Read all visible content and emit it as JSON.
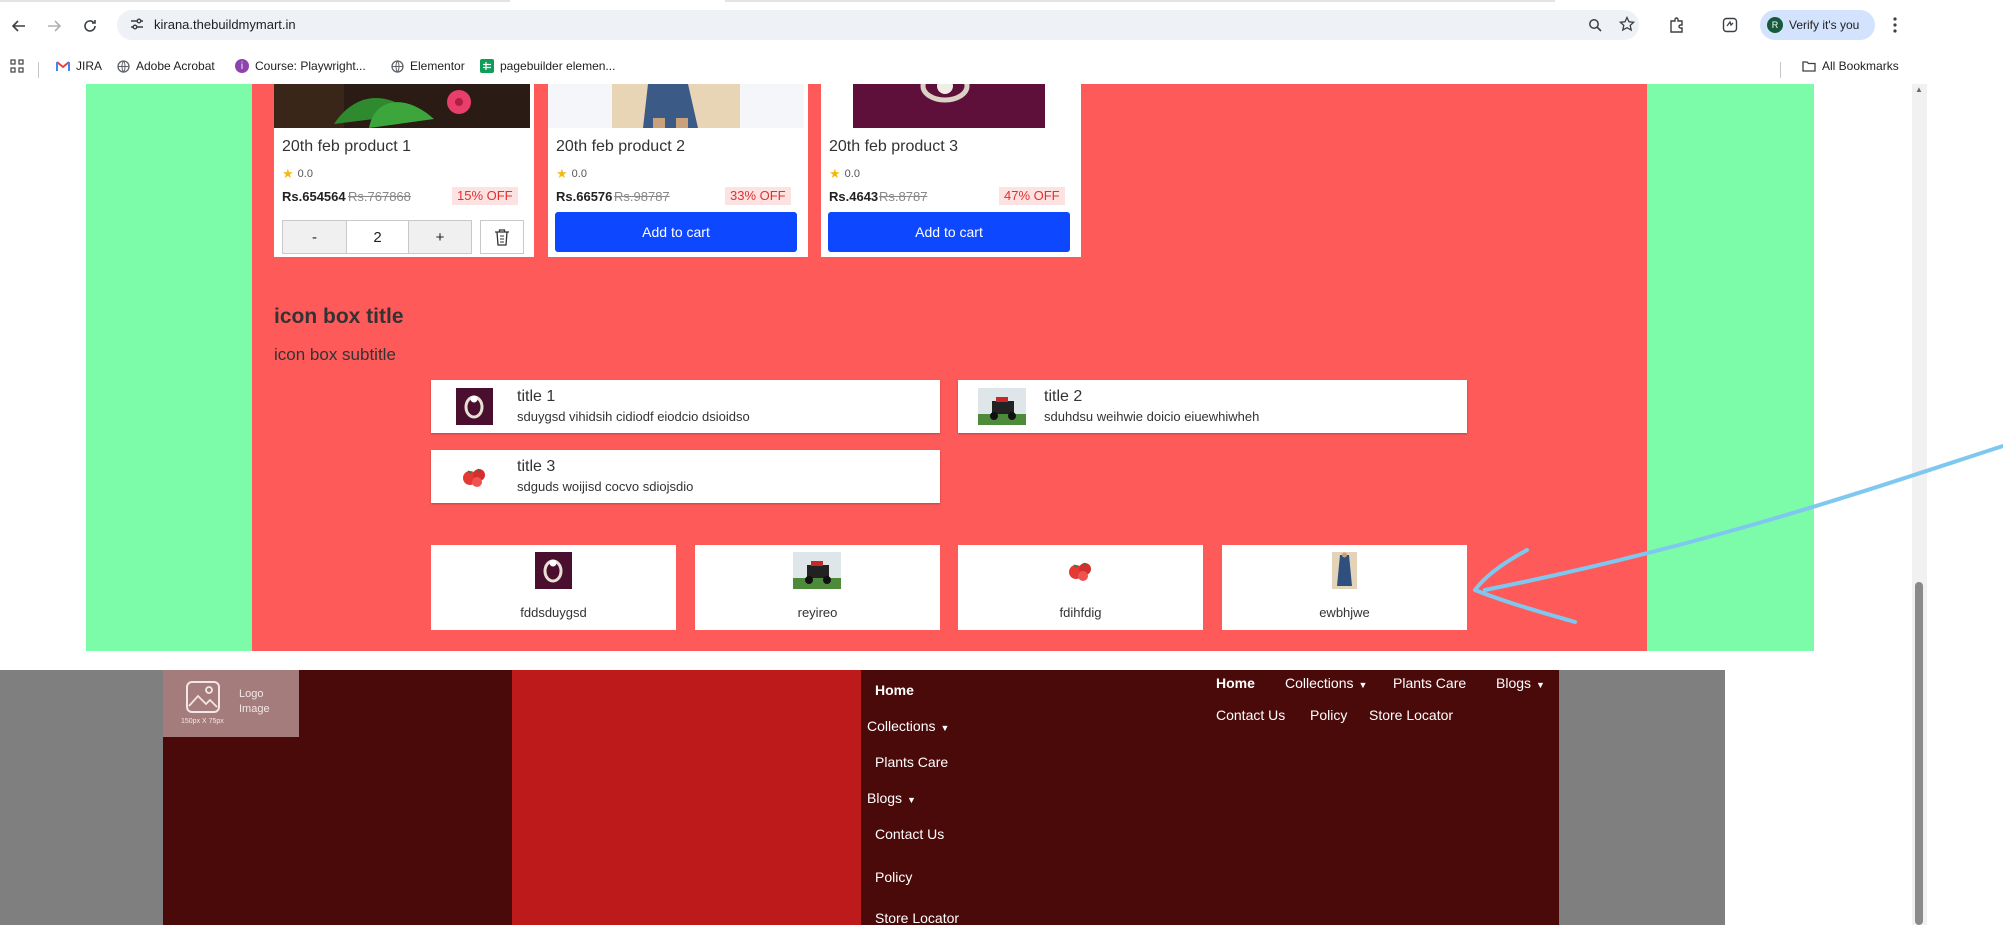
{
  "browser": {
    "url": "kirana.thebuildmymart.in",
    "verify_label": "Verify it's you",
    "avatar_initial": "R",
    "bookmarks": [
      {
        "label": "JIRA",
        "icon": "gmail-icon",
        "color": "#ea4335"
      },
      {
        "label": "Adobe Acrobat",
        "icon": "globe-icon",
        "color": "#5f6368"
      },
      {
        "label": "Course: Playwright...",
        "icon": "course-icon",
        "color": "#8e44ad"
      },
      {
        "label": "Elementor",
        "icon": "globe-icon",
        "color": "#5f6368"
      },
      {
        "label": "pagebuilder elemen...",
        "icon": "sheets-icon",
        "color": "#0f9d58"
      }
    ],
    "all_bookmarks": "All Bookmarks"
  },
  "products": [
    {
      "name": "20th feb product 1",
      "rating": "0.0",
      "price": "Rs.654564",
      "mrp": "Rs.767868",
      "discount": "15% OFF",
      "quantity": "2",
      "in_cart": true
    },
    {
      "name": "20th feb product 2",
      "rating": "0.0",
      "price": "Rs.66576",
      "mrp": "Rs.98787",
      "discount": "33% OFF",
      "button": "Add to cart",
      "in_cart": false
    },
    {
      "name": "20th feb product 3",
      "rating": "0.0",
      "price": "Rs.4643",
      "mrp": "Rs.8787",
      "discount": "47% OFF",
      "button": "Add to cart",
      "in_cart": false
    }
  ],
  "cart_controls": {
    "minus": "-",
    "plus": "+"
  },
  "icon_box": {
    "title": "icon box title",
    "subtitle": "icon box subtitle",
    "items": [
      {
        "title": "title 1",
        "text": "sduygsd vihidsih cidiodf eiodcio dsioidso",
        "image": "ring-thumbnail"
      },
      {
        "title": "title 2",
        "text": "sduhdsu weihwie doicio eiuewhiwheh",
        "image": "lawnmower-thumbnail"
      },
      {
        "title": "title 3",
        "text": "sdguds woijisd cocvo sdiojsdio",
        "image": "tomato-thumbnail"
      }
    ]
  },
  "categories": [
    {
      "label": "fddsduygsd",
      "image": "ring-thumbnail"
    },
    {
      "label": "reyireo",
      "image": "lawnmower-thumbnail"
    },
    {
      "label": "fdihfdig",
      "image": "tomato-thumbnail"
    },
    {
      "label": "ewbhjwe",
      "image": "dress-thumbnail"
    }
  ],
  "footer": {
    "logo": {
      "label_line1": "Logo",
      "label_line2": "Image",
      "size_note": "150px X 75px"
    },
    "menu_vertical": [
      {
        "label": "Home",
        "bold": true,
        "dropdown": false
      },
      {
        "label": "Collections",
        "bold": false,
        "dropdown": true
      },
      {
        "label": "Plants Care",
        "bold": false,
        "dropdown": false
      },
      {
        "label": "Blogs",
        "bold": false,
        "dropdown": true
      },
      {
        "label": "Contact Us",
        "bold": false,
        "dropdown": false
      },
      {
        "label": "Policy",
        "bold": false,
        "dropdown": false
      },
      {
        "label": "Store Locator",
        "bold": false,
        "dropdown": false
      }
    ],
    "menu_horizontal": [
      {
        "label": "Home",
        "bold": true,
        "dropdown": false
      },
      {
        "label": "Collections",
        "bold": false,
        "dropdown": true
      },
      {
        "label": "Plants Care",
        "bold": false,
        "dropdown": false
      },
      {
        "label": "Blogs",
        "bold": false,
        "dropdown": true
      },
      {
        "label": "Contact Us",
        "bold": false,
        "dropdown": false
      },
      {
        "label": "Policy",
        "bold": false,
        "dropdown": false
      },
      {
        "label": "Store Locator",
        "bold": false,
        "dropdown": false
      }
    ]
  },
  "colors": {
    "green_band": "#7cfca8",
    "red_band": "#fe5a5a",
    "add_to_cart": "#0d47ff",
    "footer_dark": "#4a0a0a",
    "footer_red": "#bd1b1b",
    "annotation_stroke": "#7ec8f0"
  }
}
